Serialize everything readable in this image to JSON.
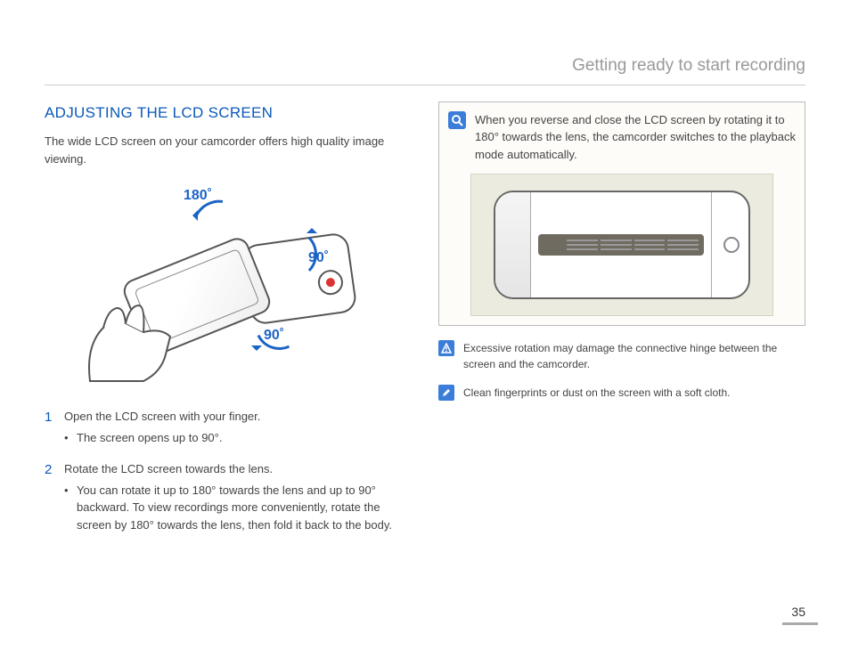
{
  "chapter_title": "Getting ready to start recording",
  "section_title": "ADJUSTING THE LCD SCREEN",
  "intro": "The wide LCD screen on your camcorder offers high quality image viewing.",
  "angles": {
    "a180": "180˚",
    "a90_top": "90˚",
    "a90_bottom": "90˚"
  },
  "steps": [
    {
      "num": "1",
      "text": "Open the LCD screen with your finger.",
      "bullets": [
        "The screen opens up to 90°."
      ]
    },
    {
      "num": "2",
      "text": "Rotate the LCD screen towards the lens.",
      "bullets": [
        "You can rotate it up to 180° towards the lens and up to 90° backward. To view recordings more conveniently, rotate the screen by 180° towards the lens, then fold it back to the body."
      ]
    }
  ],
  "info_box_text": "When you reverse and close the LCD screen by rotating it to 180° towards the lens, the camcorder switches to the playback mode automatically.",
  "warning_text": "Excessive rotation may damage the connective hinge between the screen and the camcorder.",
  "tip_text": "Clean fingerprints or dust on the screen with a soft cloth.",
  "page_number": "35"
}
